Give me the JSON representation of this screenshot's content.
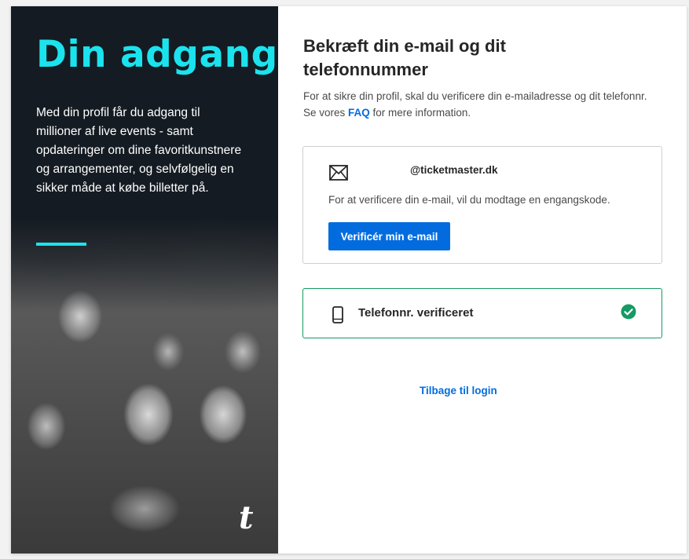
{
  "hero": {
    "title": "Din adgang",
    "text": "Med din profil får du adgang til millioner af live events - samt opdateringer om dine favoritkunstnere og arrangementer, og selvfølgelig en sikker måde at købe billetter på.",
    "logo": "t",
    "accent_color": "#1be3ee",
    "background_color": "#141b22"
  },
  "main": {
    "heading": "Bekræft din e-mail og dit telefonnummer",
    "intro_before": "For at sikre din profil, skal du verificere din e-mailadresse og dit telefonnr. Se vores ",
    "faq_link": "FAQ",
    "intro_after": " for mere information."
  },
  "email_card": {
    "icon": "envelope-icon",
    "address": "@ticketmaster.dk",
    "description": "For at verificere din e-mail, vil du modtage en engangskode.",
    "button_label": "Verificér min e-mail",
    "button_color": "#026cdf"
  },
  "phone_card": {
    "icon": "mobile-phone-icon",
    "label": "Telefonnr. verificeret",
    "status_icon": "check-circle-icon",
    "status_color": "#149a63"
  },
  "back_link": "Tilbage til login"
}
